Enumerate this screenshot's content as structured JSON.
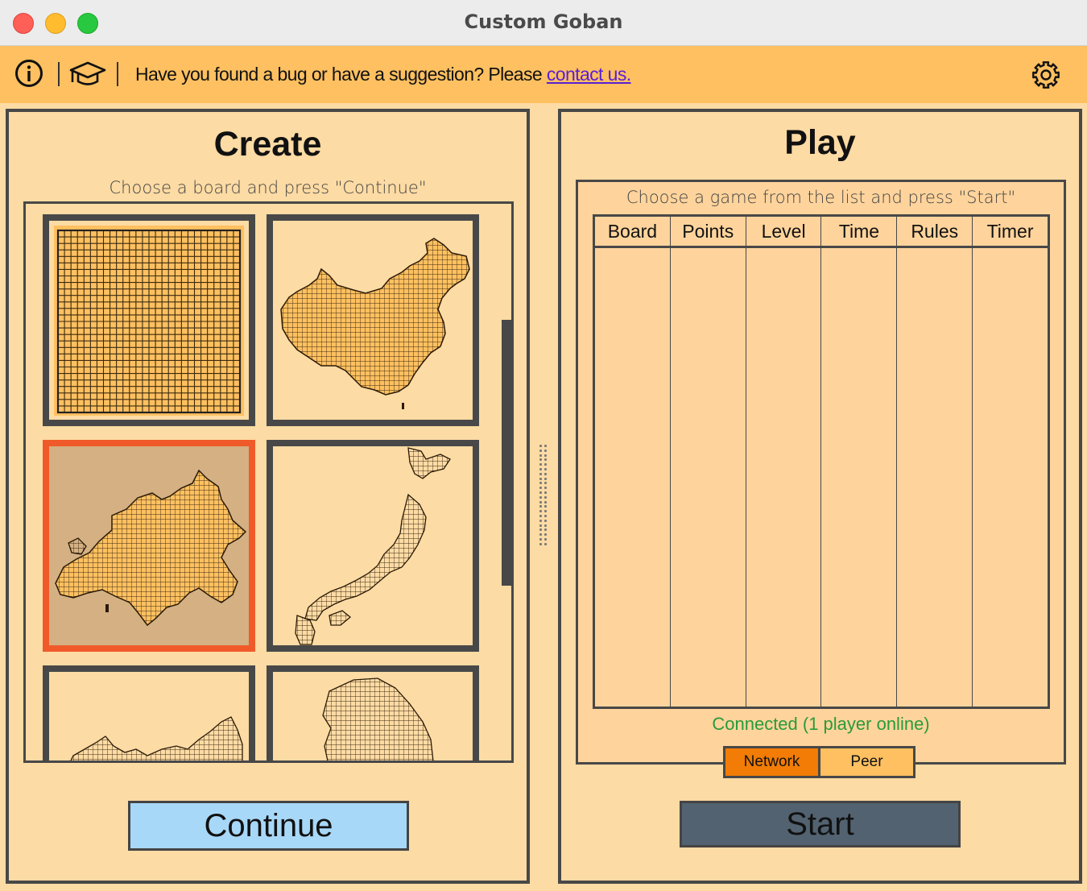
{
  "window": {
    "title": "Custom Goban"
  },
  "toolbar": {
    "message": "Have you found a bug or have a suggestion? Please ",
    "link_text": "contact us."
  },
  "create": {
    "title": "Create",
    "subtitle": "Choose a board and press \"Continue\"",
    "selected_index": 2,
    "continue_label": "Continue"
  },
  "play": {
    "title": "Play",
    "subtitle": "Choose a game from the list and press \"Start\"",
    "columns": [
      "Board",
      "Points",
      "Level",
      "Time",
      "Rules",
      "Timer"
    ],
    "status": "Connected (1 player online)",
    "modes": [
      "Network",
      "Peer"
    ],
    "active_mode": "Network",
    "start_label": "Start"
  },
  "colors": {
    "toolbar": "#fec060",
    "panel": "#fddba4",
    "selected_border": "#f05a2a",
    "continue_button": "#a8d8f8",
    "start_button": "#526270",
    "status_text": "#2a9a3a",
    "active_mode": "#f27c05"
  }
}
